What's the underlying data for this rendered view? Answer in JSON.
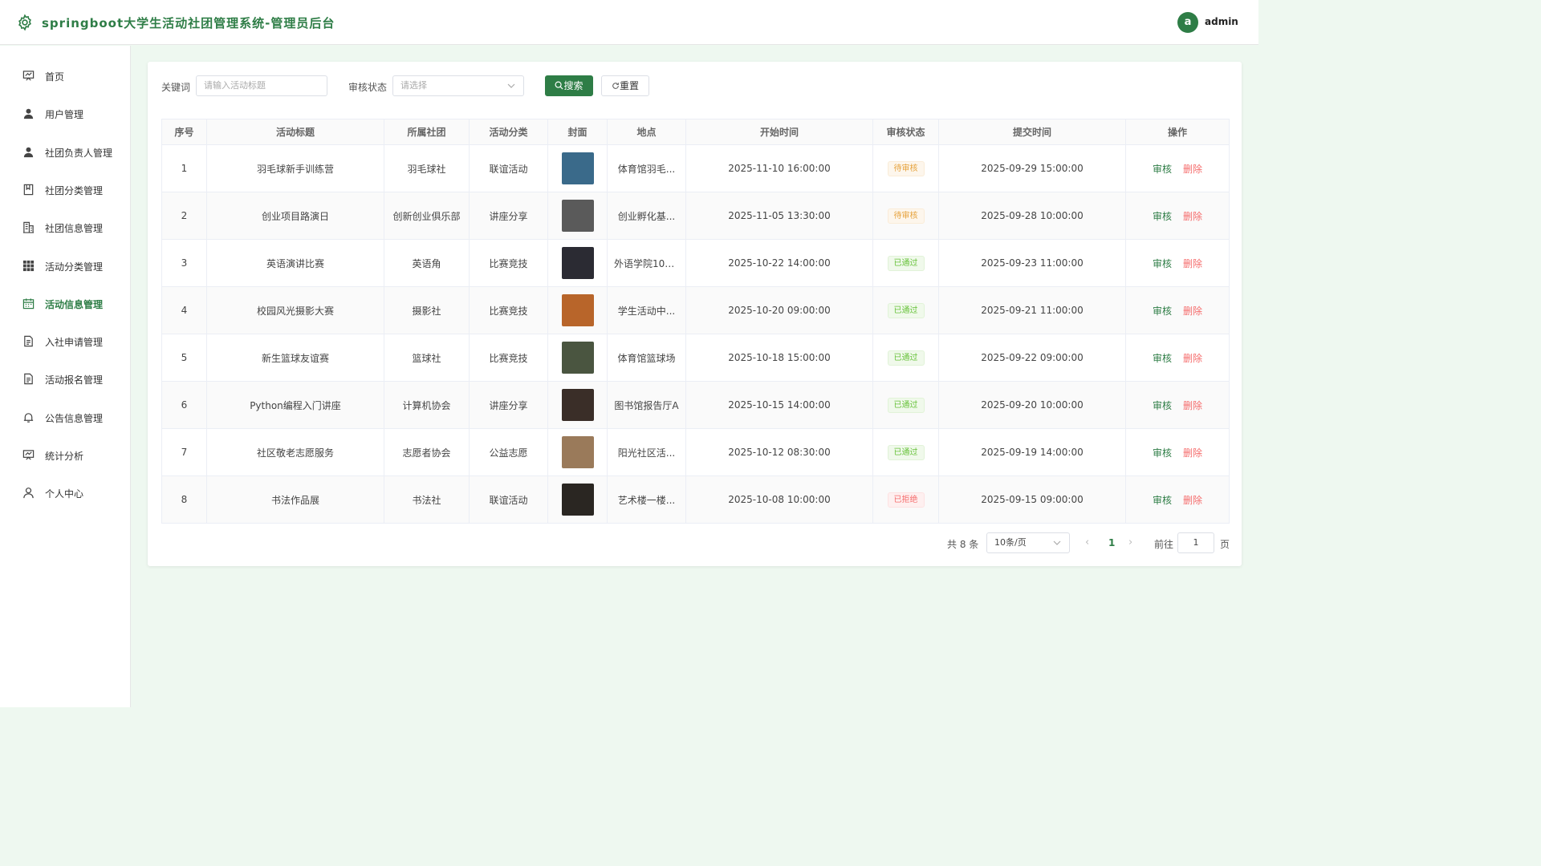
{
  "header": {
    "title": "springboot大学生活动社团管理系统-管理员后台",
    "avatar_letter": "a",
    "username": "admin"
  },
  "sidebar": {
    "items": [
      {
        "label": "首页",
        "icon": "home-icon"
      },
      {
        "label": "用户管理",
        "icon": "user-icon"
      },
      {
        "label": "社团负责人管理",
        "icon": "user-icon"
      },
      {
        "label": "社团分类管理",
        "icon": "bookmark-icon"
      },
      {
        "label": "社团信息管理",
        "icon": "building-icon"
      },
      {
        "label": "活动分类管理",
        "icon": "grid-icon"
      },
      {
        "label": "活动信息管理",
        "icon": "calendar-icon",
        "active": true
      },
      {
        "label": "入社申请管理",
        "icon": "document-icon"
      },
      {
        "label": "活动报名管理",
        "icon": "document-icon"
      },
      {
        "label": "公告信息管理",
        "icon": "bell-icon"
      },
      {
        "label": "统计分析",
        "icon": "chart-icon"
      },
      {
        "label": "个人中心",
        "icon": "person-icon"
      }
    ]
  },
  "filters": {
    "keyword_label": "关键词",
    "keyword_placeholder": "请输入活动标题",
    "status_label": "审核状态",
    "status_placeholder": "请选择",
    "search_button": "搜索",
    "reset_button": "重置"
  },
  "table": {
    "columns": [
      "序号",
      "活动标题",
      "所属社团",
      "活动分类",
      "封面",
      "地点",
      "开始时间",
      "审核状态",
      "提交时间",
      "操作"
    ],
    "rows": [
      {
        "no": "1",
        "title": "羽毛球新手训练营",
        "club": "羽毛球社",
        "category": "联谊活动",
        "location": "体育馆羽毛...",
        "start": "2025-11-10 16:00:00",
        "status": "待审核",
        "status_type": "pending",
        "submitted": "2025-09-29 15:00:00",
        "cover_color": "#3a6a8a"
      },
      {
        "no": "2",
        "title": "创业项目路演日",
        "club": "创新创业俱乐部",
        "category": "讲座分享",
        "location": "创业孵化基...",
        "start": "2025-11-05 13:30:00",
        "status": "待审核",
        "status_type": "pending",
        "submitted": "2025-09-28 10:00:00",
        "cover_color": "#5a5a5a"
      },
      {
        "no": "3",
        "title": "英语演讲比赛",
        "club": "英语角",
        "category": "比赛竞技",
        "location": "外语学院101...",
        "start": "2025-10-22 14:00:00",
        "status": "已通过",
        "status_type": "passed",
        "submitted": "2025-09-23 11:00:00",
        "cover_color": "#2b2b33"
      },
      {
        "no": "4",
        "title": "校园风光摄影大赛",
        "club": "摄影社",
        "category": "比赛竞技",
        "location": "学生活动中...",
        "start": "2025-10-20 09:00:00",
        "status": "已通过",
        "status_type": "passed",
        "submitted": "2025-09-21 11:00:00",
        "cover_color": "#b8652a"
      },
      {
        "no": "5",
        "title": "新生篮球友谊赛",
        "club": "篮球社",
        "category": "比赛竞技",
        "location": "体育馆篮球场",
        "start": "2025-10-18 15:00:00",
        "status": "已通过",
        "status_type": "passed",
        "submitted": "2025-09-22 09:00:00",
        "cover_color": "#4a5540"
      },
      {
        "no": "6",
        "title": "Python编程入门讲座",
        "club": "计算机协会",
        "category": "讲座分享",
        "location": "图书馆报告厅A",
        "start": "2025-10-15 14:00:00",
        "status": "已通过",
        "status_type": "passed",
        "submitted": "2025-09-20 10:00:00",
        "cover_color": "#3a2e28"
      },
      {
        "no": "7",
        "title": "社区敬老志愿服务",
        "club": "志愿者协会",
        "category": "公益志愿",
        "location": "阳光社区活...",
        "start": "2025-10-12 08:30:00",
        "status": "已通过",
        "status_type": "passed",
        "submitted": "2025-09-19 14:00:00",
        "cover_color": "#9a7a5a"
      },
      {
        "no": "8",
        "title": "书法作品展",
        "club": "书法社",
        "category": "联谊活动",
        "location": "艺术楼一楼...",
        "start": "2025-10-08 10:00:00",
        "status": "已拒绝",
        "status_type": "rejected",
        "submitted": "2025-09-15 09:00:00",
        "cover_color": "#2a2622"
      }
    ],
    "review_label": "审核",
    "delete_label": "删除"
  },
  "pagination": {
    "total_text": "共 8 条",
    "page_size": "10条/页",
    "current_page": "1",
    "goto_label": "前往",
    "jump_value": "1",
    "page_unit": "页"
  },
  "colors": {
    "primary": "#2e7d46",
    "background": "#eef8f0"
  }
}
